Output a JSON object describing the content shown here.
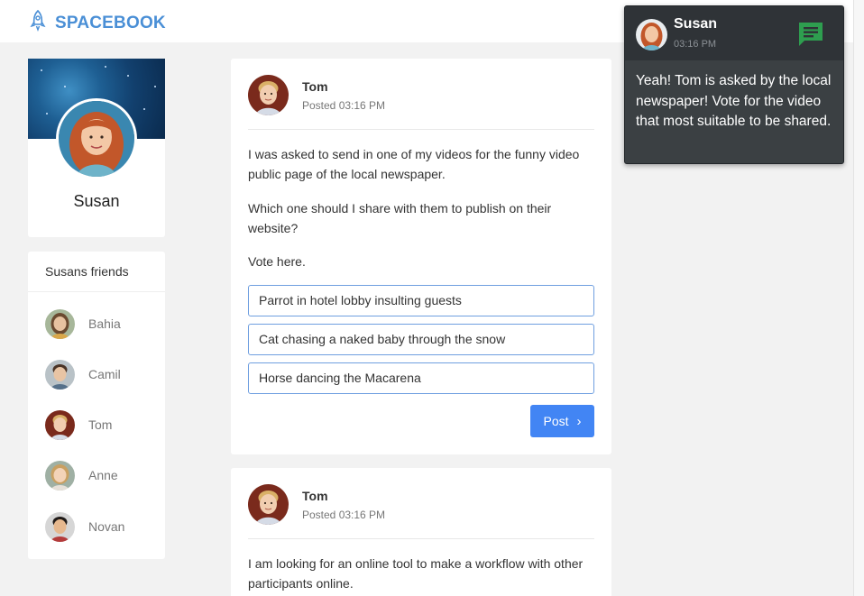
{
  "app": {
    "brand": "SPACEBOOK",
    "brand_color": "#4a8fd6",
    "logo_icon": "rocket-icon"
  },
  "profile": {
    "name": "Susan"
  },
  "friends": {
    "title": "Susans friends",
    "items": [
      {
        "name": "Bahia"
      },
      {
        "name": "Camil"
      },
      {
        "name": "Tom"
      },
      {
        "name": "Anne"
      },
      {
        "name": "Novan"
      }
    ]
  },
  "posts": [
    {
      "author": "Tom",
      "posted": "Posted 03:16 PM",
      "paragraphs": [
        "I was asked to send in one of my videos for the funny video public page of the local newspaper.",
        "Which one should I share with them to publish on their website?",
        "Vote here."
      ],
      "options": [
        "Parrot in hotel lobby insulting guests",
        "Cat chasing a naked baby through the snow",
        "Horse dancing the Macarena"
      ],
      "submit_label": "Post",
      "submit_icon": "chevron-right-icon"
    },
    {
      "author": "Tom",
      "posted": "Posted 03:16 PM",
      "paragraphs": [
        "I am looking for an online tool to make a workflow with other participants online."
      ]
    }
  ],
  "notification": {
    "name": "Susan",
    "time": "03:16 PM",
    "message": "Yeah! Tom is asked by the local newspaper! Vote for the video that most suitable to be shared.",
    "icon": "chat-message-icon",
    "icon_color": "#2e9e4f"
  },
  "colors": {
    "accent": "#4285f4",
    "background": "#f2f2f2",
    "notification_bg": "#3b4043"
  }
}
